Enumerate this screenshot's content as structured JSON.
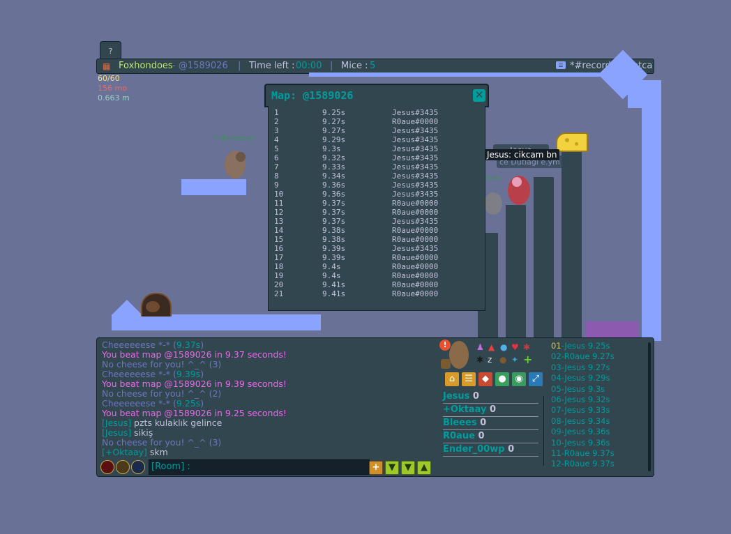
{
  "help": {
    "label": "?"
  },
  "header": {
    "player": "Foxhondoes",
    "map_code": "- @1589026",
    "sep1": "|",
    "time_label": "Time left :",
    "time_value": "00:00",
    "sep2": "|",
    "mice_label": "Mice :",
    "mice_value": "5",
    "room": "*#records0bootca"
  },
  "stats": {
    "fps": "60/60",
    "ms": "156 mo",
    "dist": "0.663 m"
  },
  "map_labels": {
    "mouse1": "Enibleeeswp",
    "mouse2_name": "Jesus",
    "mouse2_tag": "ce Dutlagi e.ym",
    "chat_bubble": "Jesus: cikcam bn",
    "mouse3": "taay"
  },
  "map_dialog": {
    "title": "Map: @1589026",
    "close": "✕",
    "records": [
      {
        "pos": "1",
        "time": "9.25s",
        "name": "Jesus#3435"
      },
      {
        "pos": "2",
        "time": "9.27s",
        "name": "R0aue#0000"
      },
      {
        "pos": "3",
        "time": "9.27s",
        "name": "Jesus#3435"
      },
      {
        "pos": "4",
        "time": "9.29s",
        "name": "Jesus#3435"
      },
      {
        "pos": "5",
        "time": "9.3s",
        "name": "Jesus#3435"
      },
      {
        "pos": "6",
        "time": "9.32s",
        "name": "Jesus#3435"
      },
      {
        "pos": "7",
        "time": "9.33s",
        "name": "Jesus#3435"
      },
      {
        "pos": "8",
        "time": "9.34s",
        "name": "Jesus#3435"
      },
      {
        "pos": "9",
        "time": "9.36s",
        "name": "Jesus#3435"
      },
      {
        "pos": "10",
        "time": "9.36s",
        "name": "Jesus#3435"
      },
      {
        "pos": "11",
        "time": "9.37s",
        "name": "R0aue#0000"
      },
      {
        "pos": "12",
        "time": "9.37s",
        "name": "R0aue#0000"
      },
      {
        "pos": "13",
        "time": "9.37s",
        "name": "Jesus#3435"
      },
      {
        "pos": "14",
        "time": "9.38s",
        "name": "R0aue#0000"
      },
      {
        "pos": "15",
        "time": "9.38s",
        "name": "R0aue#0000"
      },
      {
        "pos": "16",
        "time": "9.39s",
        "name": "Jesus#3435"
      },
      {
        "pos": "17",
        "time": "9.39s",
        "name": "R0aue#0000"
      },
      {
        "pos": "18",
        "time": "9.4s",
        "name": "R0aue#0000"
      },
      {
        "pos": "19",
        "time": "9.4s",
        "name": "R0aue#0000"
      },
      {
        "pos": "20",
        "time": "9.41s",
        "name": "R0aue#0000"
      },
      {
        "pos": "21",
        "time": "9.41s",
        "name": "R0aue#0000"
      }
    ]
  },
  "chat": [
    {
      "parts": [
        {
          "t": "Cheeeeeese *-* (",
          "c": "lblue"
        },
        {
          "t": "9.37s",
          "c": "cyan"
        },
        {
          "t": ")",
          "c": "lblue"
        }
      ]
    },
    {
      "parts": [
        {
          "t": "You beat map @1589026 in 9.37 seconds!",
          "c": "pink"
        }
      ]
    },
    {
      "parts": [
        {
          "t": "No cheese for you! ^_^ (3)",
          "c": "lblue"
        }
      ]
    },
    {
      "parts": [
        {
          "t": "Cheeeeeese *-* (",
          "c": "lblue"
        },
        {
          "t": "9.39s",
          "c": "cyan"
        },
        {
          "t": ")",
          "c": "lblue"
        }
      ]
    },
    {
      "parts": [
        {
          "t": "You beat map @1589026 in 9.39 seconds!",
          "c": "pink"
        }
      ]
    },
    {
      "parts": [
        {
          "t": "No cheese for you! ^_^ (2)",
          "c": "lblue"
        }
      ]
    },
    {
      "parts": [
        {
          "t": "Cheeeeeese *-* (",
          "c": "lblue"
        },
        {
          "t": "9.25s",
          "c": "cyan"
        },
        {
          "t": ")",
          "c": "lblue"
        }
      ]
    },
    {
      "parts": [
        {
          "t": "You beat map @1589026 in 9.25 seconds!",
          "c": "pink"
        }
      ]
    },
    {
      "parts": [
        {
          "t": "[Jesus]",
          "c": "cyan"
        },
        {
          "t": " pzts kulaklık gelince",
          "c": "wh"
        }
      ]
    },
    {
      "parts": [
        {
          "t": "[Jesus]",
          "c": "cyan"
        },
        {
          "t": " sikiş",
          "c": "wh"
        }
      ]
    },
    {
      "parts": [
        {
          "t": "No cheese for you! ^_^ (3)",
          "c": "lblue"
        }
      ]
    },
    {
      "parts": [
        {
          "t": "[+Oktaay]",
          "c": "cyan"
        },
        {
          "t": " skm",
          "c": "wh"
        }
      ]
    }
  ],
  "chat_input": {
    "prefix": "[Room] :",
    "value": ""
  },
  "players": [
    {
      "name": "Jesus",
      "score": "0"
    },
    {
      "name": "+Oktaay",
      "score": "0"
    },
    {
      "name": "Bleees",
      "score": "0"
    },
    {
      "name": "R0aue",
      "score": "0"
    },
    {
      "name": "Ender_00wp",
      "score": "0"
    }
  ],
  "leaderboard": [
    {
      "rank": "01",
      "name": "Jesus",
      "time": "9.25s"
    },
    {
      "rank": "02",
      "name": "R0aue",
      "time": "9.27s"
    },
    {
      "rank": "03",
      "name": "Jesus",
      "time": "9.27s"
    },
    {
      "rank": "04",
      "name": "Jesus",
      "time": "9.29s"
    },
    {
      "rank": "05",
      "name": "Jesus",
      "time": "9.3s"
    },
    {
      "rank": "06",
      "name": "Jesus",
      "time": "9.32s"
    },
    {
      "rank": "07",
      "name": "Jesus",
      "time": "9.33s"
    },
    {
      "rank": "08",
      "name": "Jesus",
      "time": "9.34s"
    },
    {
      "rank": "09",
      "name": "Jesus",
      "time": "9.36s"
    },
    {
      "rank": "10",
      "name": "Jesus",
      "time": "9.36s"
    },
    {
      "rank": "11",
      "name": "R0aue",
      "time": "9.37s"
    },
    {
      "rank": "12",
      "name": "R0aue",
      "time": "9.37s"
    }
  ],
  "colors": {
    "panel": "#324650",
    "accent": "#009d9d",
    "ground": "#8aa3ff",
    "background": "#6a7196"
  }
}
